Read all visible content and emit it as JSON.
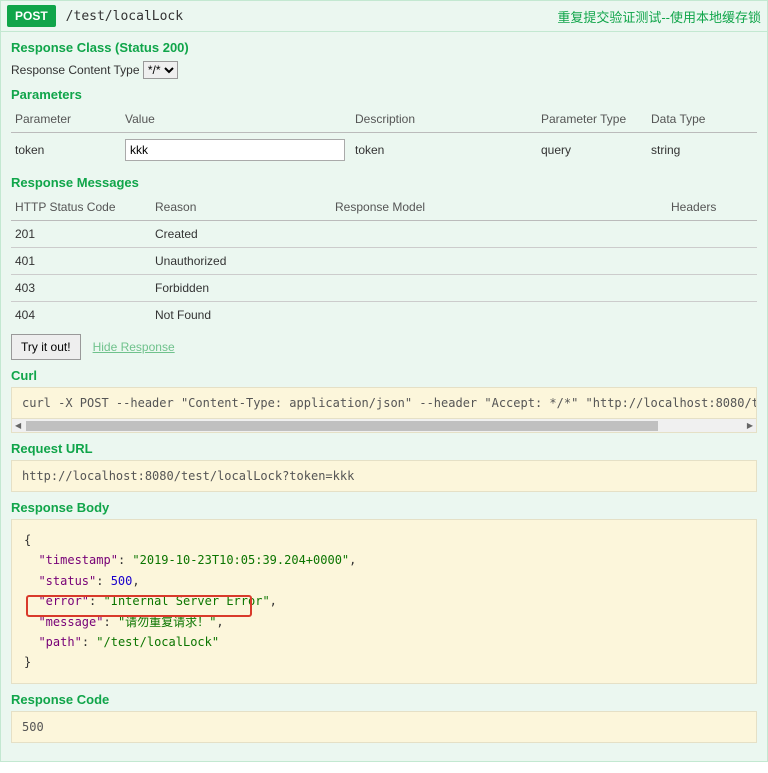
{
  "header": {
    "method": "POST",
    "path": "/test/localLock",
    "summary": "重复提交验证测试--使用本地缓存锁"
  },
  "responseClass": {
    "title": "Response Class (Status 200)",
    "contentTypeLabel": "Response Content Type",
    "contentTypeValue": "*/*"
  },
  "parameters": {
    "title": "Parameters",
    "headers": {
      "param": "Parameter",
      "value": "Value",
      "desc": "Description",
      "ptype": "Parameter Type",
      "dtype": "Data Type"
    },
    "rows": [
      {
        "name": "token",
        "value": "kkk",
        "desc": "token",
        "ptype": "query",
        "dtype": "string"
      }
    ]
  },
  "responseMessages": {
    "title": "Response Messages",
    "headers": {
      "code": "HTTP Status Code",
      "reason": "Reason",
      "model": "Response Model",
      "headers": "Headers"
    },
    "rows": [
      {
        "code": "201",
        "reason": "Created"
      },
      {
        "code": "401",
        "reason": "Unauthorized"
      },
      {
        "code": "403",
        "reason": "Forbidden"
      },
      {
        "code": "404",
        "reason": "Not Found"
      }
    ]
  },
  "buttons": {
    "tryItOut": "Try it out!",
    "hideResponse": "Hide Response"
  },
  "curl": {
    "title": "Curl",
    "value": "curl -X POST --header \"Content-Type: application/json\" --header \"Accept: */*\" \"http://localhost:8080/test/localL"
  },
  "requestUrl": {
    "title": "Request URL",
    "value": "http://localhost:8080/test/localLock?token=kkk"
  },
  "responseBody": {
    "title": "Response Body",
    "json": {
      "timestamp": "2019-10-23T10:05:39.204+0000",
      "status": 500,
      "error": "Internal Server Error",
      "message": "请勿重复请求！",
      "path": "/test/localLock"
    }
  },
  "responseCode": {
    "title": "Response Code",
    "value": "500"
  }
}
